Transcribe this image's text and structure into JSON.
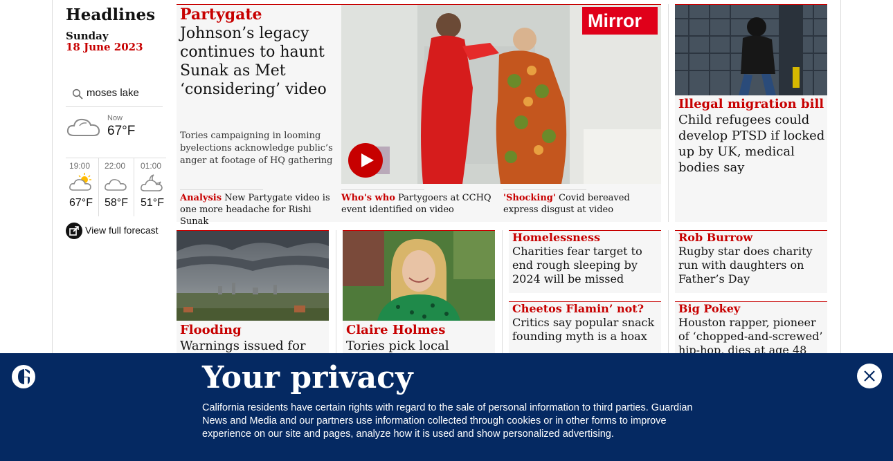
{
  "sidebar": {
    "title": "Headlines",
    "day": "Sunday",
    "date": "18 June 2023",
    "location": "moses lake",
    "now_label": "Now",
    "now_temp": "67°F",
    "now_icon": "cloudy-icon",
    "hours": [
      {
        "time": "19:00",
        "temp": "67°F",
        "icon": "partly-sunny-icon"
      },
      {
        "time": "22:00",
        "temp": "58°F",
        "icon": "cloud-icon"
      },
      {
        "time": "01:00",
        "temp": "51°F",
        "icon": "partly-cloudy-night-icon"
      }
    ],
    "forecast_label": "View full forecast"
  },
  "lead": {
    "kicker": "Partygate",
    "headline": "Johnson’s legacy continues to haunt Sunak as Met ‘considering’ video",
    "trail": "Tories campaigning in looming byelections acknowledge public’s anger at footage of HQ gathering",
    "video_badge": "Mirror",
    "subs": [
      {
        "kicker": "Analysis",
        "text": "New Partygate video is one more headache for Rishi Sunak"
      },
      {
        "kicker": "Who's who",
        "text": "Partygoers at CCHQ event identified on video"
      },
      {
        "kicker": "'Shocking'",
        "text": "Covid bereaved express disgust at video"
      }
    ]
  },
  "migration": {
    "kicker": "Illegal migration bill",
    "headline": "Child refugees could develop PTSD if locked up by UK, medical bodies say"
  },
  "row2": {
    "flooding": {
      "kicker": "Flooding",
      "headline": "Warnings issued for"
    },
    "claire": {
      "kicker": "Claire Holmes",
      "headline": "Tories pick local"
    },
    "homeless": {
      "kicker": "Homelessness",
      "headline": "Charities fear target to end rough sleeping by 2024 will be missed"
    },
    "cheetos": {
      "kicker": "Cheetos Flamin’ not?",
      "headline": "Critics say popular snack founding myth is a hoax"
    },
    "burrow": {
      "kicker": "Rob Burrow",
      "headline": "Rugby star does charity run with daughters on Father’s Day"
    },
    "pokey": {
      "kicker": "Big Pokey",
      "headline": "Houston rapper, pioneer of ‘chopped-and-screwed’ hip-hop, dies at age 48"
    }
  },
  "privacy": {
    "title": "Your privacy",
    "body": "California residents have certain rights with regard to the sale of personal information to third parties. Guardian News and Media and our partners use information collected through cookies or in other forms to improve experience on our site and pages, analyze how it is used and show personalized advertising."
  },
  "colors": {
    "accent": "#c70000",
    "banner": "#052962",
    "card": "#f6f6f6"
  }
}
